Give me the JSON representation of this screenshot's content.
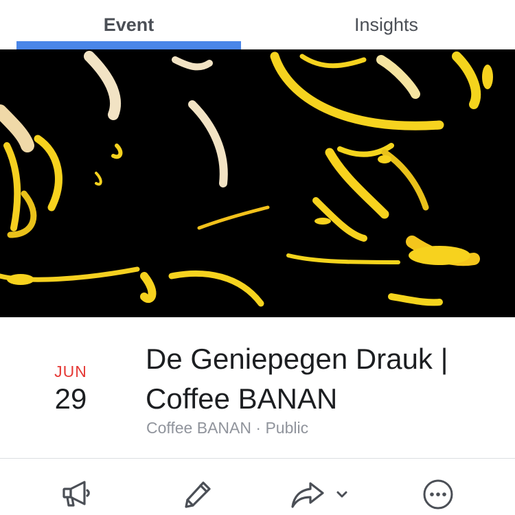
{
  "tabs": [
    {
      "label": "Event",
      "active": true
    },
    {
      "label": "Insights",
      "active": false
    }
  ],
  "colors": {
    "accent": "#4a86e8",
    "month": "#e53935",
    "text": "#1c1e21",
    "secondary": "#90949c",
    "icon": "#4b4f56"
  },
  "event": {
    "month": "JUN",
    "day": "29",
    "title_line1": "De Geniepegen Drauk |",
    "title_line2": "Coffee BANAN",
    "host": "Coffee BANAN",
    "separator": "·",
    "privacy": "Public"
  },
  "actions": [
    {
      "icon": "megaphone-icon"
    },
    {
      "icon": "pencil-icon"
    },
    {
      "icon": "share-icon"
    },
    {
      "icon": "more-icon"
    }
  ]
}
